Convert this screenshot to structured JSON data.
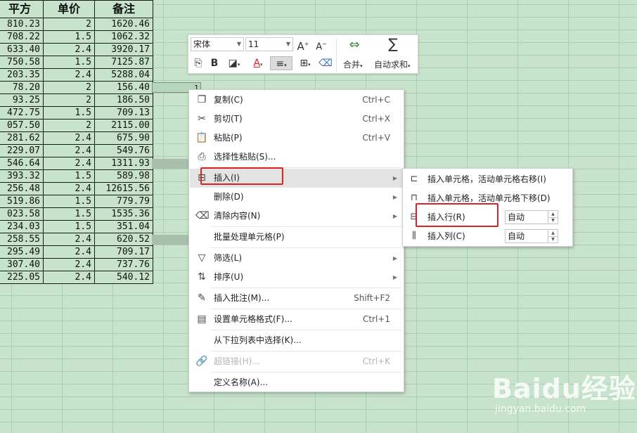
{
  "sheet": {
    "headers": [
      "平方",
      "单价",
      "备注"
    ],
    "rows": [
      [
        "810.23",
        "2",
        "1620.46"
      ],
      [
        "708.22",
        "1.5",
        "1062.32"
      ],
      [
        "633.40",
        "2.4",
        "3920.17"
      ],
      [
        "750.58",
        "1.5",
        "7125.87"
      ],
      [
        "203.35",
        "2.4",
        "5288.04"
      ],
      [
        "78.20",
        "2",
        "156.40"
      ],
      [
        "93.25",
        "2",
        "186.50"
      ],
      [
        "472.75",
        "1.5",
        "709.13"
      ],
      [
        "057.50",
        "2",
        "2115.00"
      ],
      [
        "281.62",
        "2.4",
        "675.90"
      ],
      [
        "229.07",
        "2.4",
        "549.76"
      ],
      [
        "546.64",
        "2.4",
        "1311.93"
      ],
      [
        "393.32",
        "1.5",
        "589.98"
      ],
      [
        "256.48",
        "2.4",
        "12615.56"
      ],
      [
        "519.86",
        "1.5",
        "779.79"
      ],
      [
        "023.58",
        "1.5",
        "1535.36"
      ],
      [
        "234.03",
        "1.5",
        "351.04"
      ],
      [
        "258.55",
        "2.4",
        "620.52"
      ],
      [
        "295.49",
        "2.4",
        "709.17"
      ],
      [
        "307.40",
        "2.4",
        "737.76"
      ],
      [
        "225.05",
        "2.4",
        "540.12"
      ]
    ],
    "active_cell_value": "1"
  },
  "mini_toolbar": {
    "font_name": "宋体",
    "font_size": "11",
    "merge_label": "合并",
    "autosum_label": "自动求和"
  },
  "context_menu": {
    "items": [
      {
        "label": "复制(C)",
        "shortcut": "Ctrl+C",
        "icon": "copy-icon"
      },
      {
        "label": "剪切(T)",
        "shortcut": "Ctrl+X",
        "icon": "scissors-icon"
      },
      {
        "label": "粘贴(P)",
        "shortcut": "Ctrl+V",
        "icon": "paste-icon"
      },
      {
        "label": "选择性粘贴(S)...",
        "shortcut": "",
        "icon": "paste-special-icon"
      },
      {
        "label": "插入(I)",
        "shortcut": "",
        "icon": "insert-icon"
      },
      {
        "label": "删除(D)",
        "shortcut": "",
        "icon": ""
      },
      {
        "label": "清除内容(N)",
        "shortcut": "",
        "icon": "eraser-icon"
      },
      {
        "label": "批量处理单元格(P)",
        "shortcut": "",
        "icon": ""
      },
      {
        "label": "筛选(L)",
        "shortcut": "",
        "icon": "filter-icon"
      },
      {
        "label": "排序(U)",
        "shortcut": "",
        "icon": "sort-icon"
      },
      {
        "label": "插入批注(M)...",
        "shortcut": "Shift+F2",
        "icon": "comment-icon"
      },
      {
        "label": "设置单元格格式(F)...",
        "shortcut": "Ctrl+1",
        "icon": "format-cells-icon"
      },
      {
        "label": "从下拉列表中选择(K)...",
        "shortcut": "",
        "icon": ""
      },
      {
        "label": "超链接(H)...",
        "shortcut": "Ctrl+K",
        "icon": "link-icon"
      },
      {
        "label": "定义名称(A)...",
        "shortcut": "",
        "icon": ""
      }
    ]
  },
  "insert_submenu": {
    "items": [
      {
        "label": "插入单元格，活动单元格右移(I)"
      },
      {
        "label": "插入单元格，活动单元格下移(D)"
      },
      {
        "label": "插入行(R)",
        "spin_value": "自动"
      },
      {
        "label": "插入列(C)",
        "spin_value": "自动"
      }
    ]
  },
  "watermark": {
    "brand": "Baidu经验",
    "url": "jingyan.baidu.com"
  },
  "colors": {
    "sheet_bg": "#c7e3cc",
    "highlight": "#e02020"
  }
}
